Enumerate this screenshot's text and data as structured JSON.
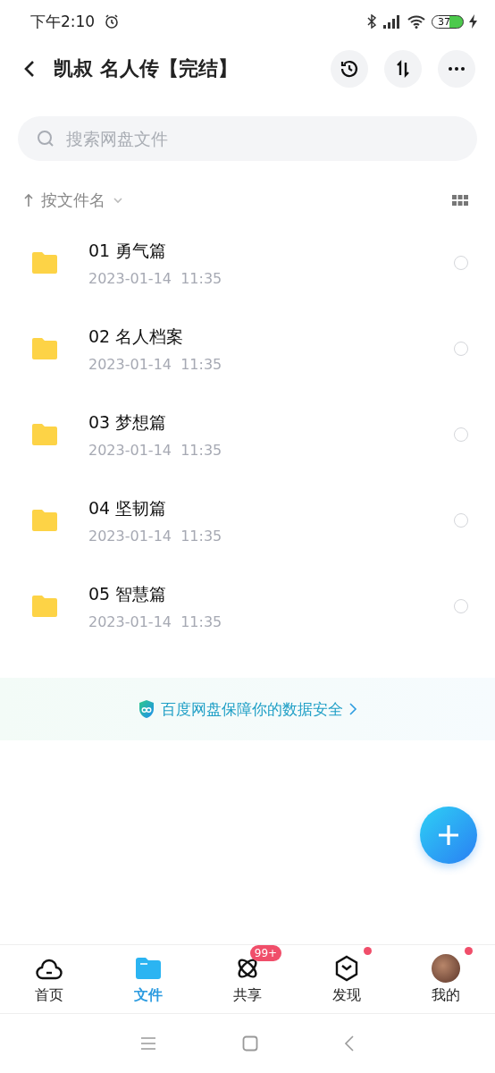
{
  "status_bar": {
    "time": "下午2:10",
    "battery": "37"
  },
  "header": {
    "title": "凯叔 名人传【完结】"
  },
  "search": {
    "placeholder": "搜索网盘文件"
  },
  "sort": {
    "label": "按文件名"
  },
  "files": [
    {
      "name": "01 勇气篇",
      "date": "2023-01-14",
      "time": "11:35",
      "selected": false
    },
    {
      "name": "02 名人档案",
      "date": "2023-01-14",
      "time": "11:35",
      "selected": false
    },
    {
      "name": "03 梦想篇",
      "date": "2023-01-14",
      "time": "11:35",
      "selected": false
    },
    {
      "name": "04 坚韧篇",
      "date": "2023-01-14",
      "time": "11:35",
      "selected": false
    },
    {
      "name": "05 智慧篇",
      "date": "2023-01-14",
      "time": "11:35",
      "selected": false
    }
  ],
  "banner": {
    "text": "百度网盘保障你的数据安全"
  },
  "tabs": [
    {
      "kind": "home",
      "label": "首页",
      "selected": false,
      "dot": false
    },
    {
      "kind": "files",
      "label": "文件",
      "selected": true,
      "dot": false
    },
    {
      "kind": "share",
      "label": "共享",
      "selected": false,
      "badge": "99+",
      "dot": false
    },
    {
      "kind": "discover",
      "label": "发现",
      "selected": false,
      "dot": true
    },
    {
      "kind": "profile",
      "label": "我的",
      "selected": false,
      "dot": true
    }
  ]
}
